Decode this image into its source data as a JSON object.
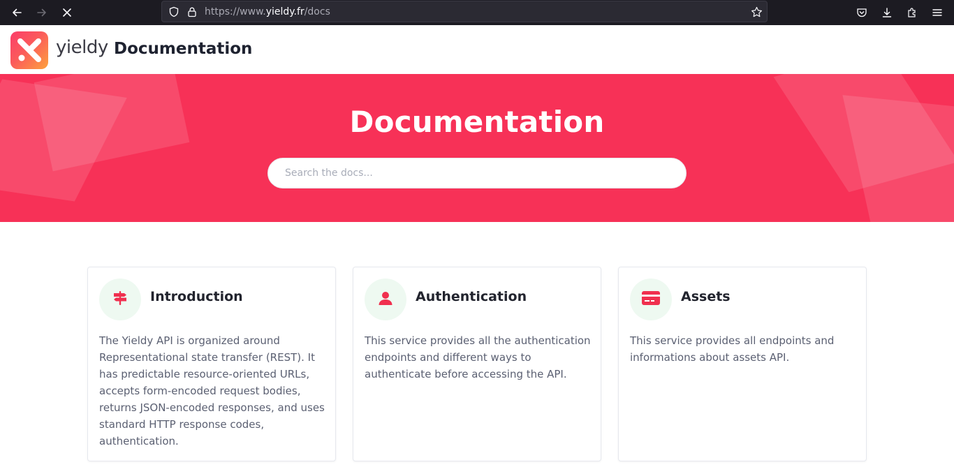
{
  "browser": {
    "url_prefix": "https://www.",
    "url_host": "yieldy.fr",
    "url_path": "/docs",
    "icons": [
      "back-arrow-icon",
      "forward-arrow-icon",
      "stop-loading-icon",
      "shield-icon",
      "lock-icon",
      "bookmark-star-icon",
      "pocket-icon",
      "download-icon",
      "extensions-icon",
      "menu-icon"
    ]
  },
  "header": {
    "logo_text": "yieldy",
    "title": "Documentation"
  },
  "hero": {
    "title": "Documentation",
    "search_placeholder": "Search the docs..."
  },
  "cards": [
    {
      "icon": "signpost-icon",
      "title": "Introduction",
      "body": "The Yieldy API is organized around Representational state transfer (REST). It has predictable resource-oriented URLs, accepts form-encoded request bodies, returns JSON-encoded responses, and uses standard HTTP response codes, authentication."
    },
    {
      "icon": "user-icon",
      "title": "Authentication",
      "body": "This service provides all the authentication endpoints and different ways to authenticate before accessing the API."
    },
    {
      "icon": "credit-card-icon",
      "title": "Assets",
      "body": "This service provides all endpoints and informations about assets API."
    }
  ],
  "colors": {
    "brand": "#f73157",
    "icon_accent": "#f0304f",
    "icon_bg": "#eef9f1"
  }
}
